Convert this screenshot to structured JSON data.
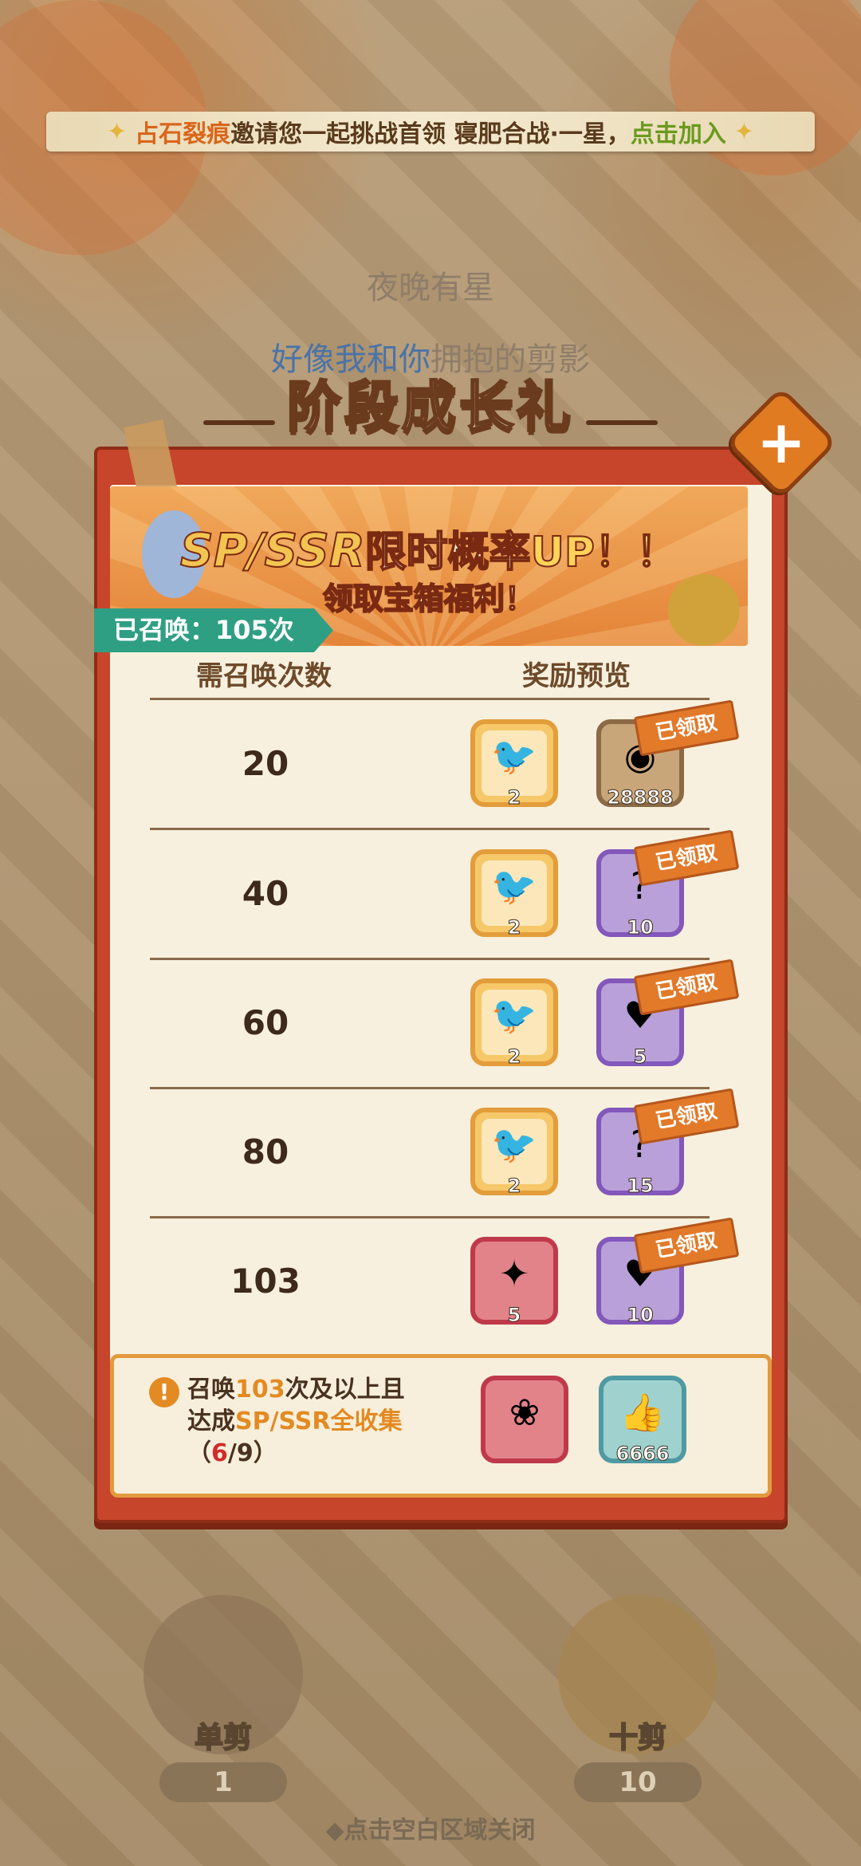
{
  "invite": {
    "player": "占石裂痕",
    "text": "邀请您一起挑战首领 寝肥合战·一星，",
    "action": "点击加入"
  },
  "lyrics": {
    "line1": "夜晚有星",
    "line2_hl": "好像我和你",
    "line2_rest": "拥抱的剪影"
  },
  "title": "阶段成长礼",
  "banner": {
    "line1_sp": "SP/SSR",
    "line1_mid": "限时概率",
    "line1_up": "UP！！",
    "line2": "领取宝箱福利！"
  },
  "summoned": "已召唤：105次",
  "columns": {
    "count": "需召唤次数",
    "reward": "奖励预览"
  },
  "claimed_label": "已领取",
  "rows": [
    {
      "count": "20",
      "item1_qty": "2",
      "item2_qty": "28888",
      "item2_icon": "coin-icon"
    },
    {
      "count": "40",
      "item1_qty": "2",
      "item2_qty": "10",
      "item2_icon": "mystery-card-icon"
    },
    {
      "count": "60",
      "item1_qty": "2",
      "item2_qty": "5",
      "item2_icon": "heart-milk-icon"
    },
    {
      "count": "80",
      "item1_qty": "2",
      "item2_qty": "15",
      "item2_icon": "mystery-card-icon"
    },
    {
      "count": "103",
      "item1_qty": "5",
      "item2_qty": "10",
      "item2_icon": "heart-milk-icon"
    }
  ],
  "bottom": {
    "line1_a": "召唤",
    "line1_num": "103",
    "line1_b": "次及以上且",
    "line2_a": "达成",
    "line2_hl": "SP/SSR全收集",
    "progress_open": "（",
    "progress_cur": "6",
    "progress_rest": "/9）",
    "item2_qty": "6666"
  },
  "summon_buttons": [
    {
      "label": "单剪",
      "cost": "1"
    },
    {
      "label": "十剪",
      "cost": "10"
    }
  ],
  "hint": "◆点击空白区域关闭",
  "colors": {
    "panel": "#c7452a",
    "paper": "#f7f0de",
    "badge": "#2f9f83",
    "accent": "#e38a22"
  }
}
